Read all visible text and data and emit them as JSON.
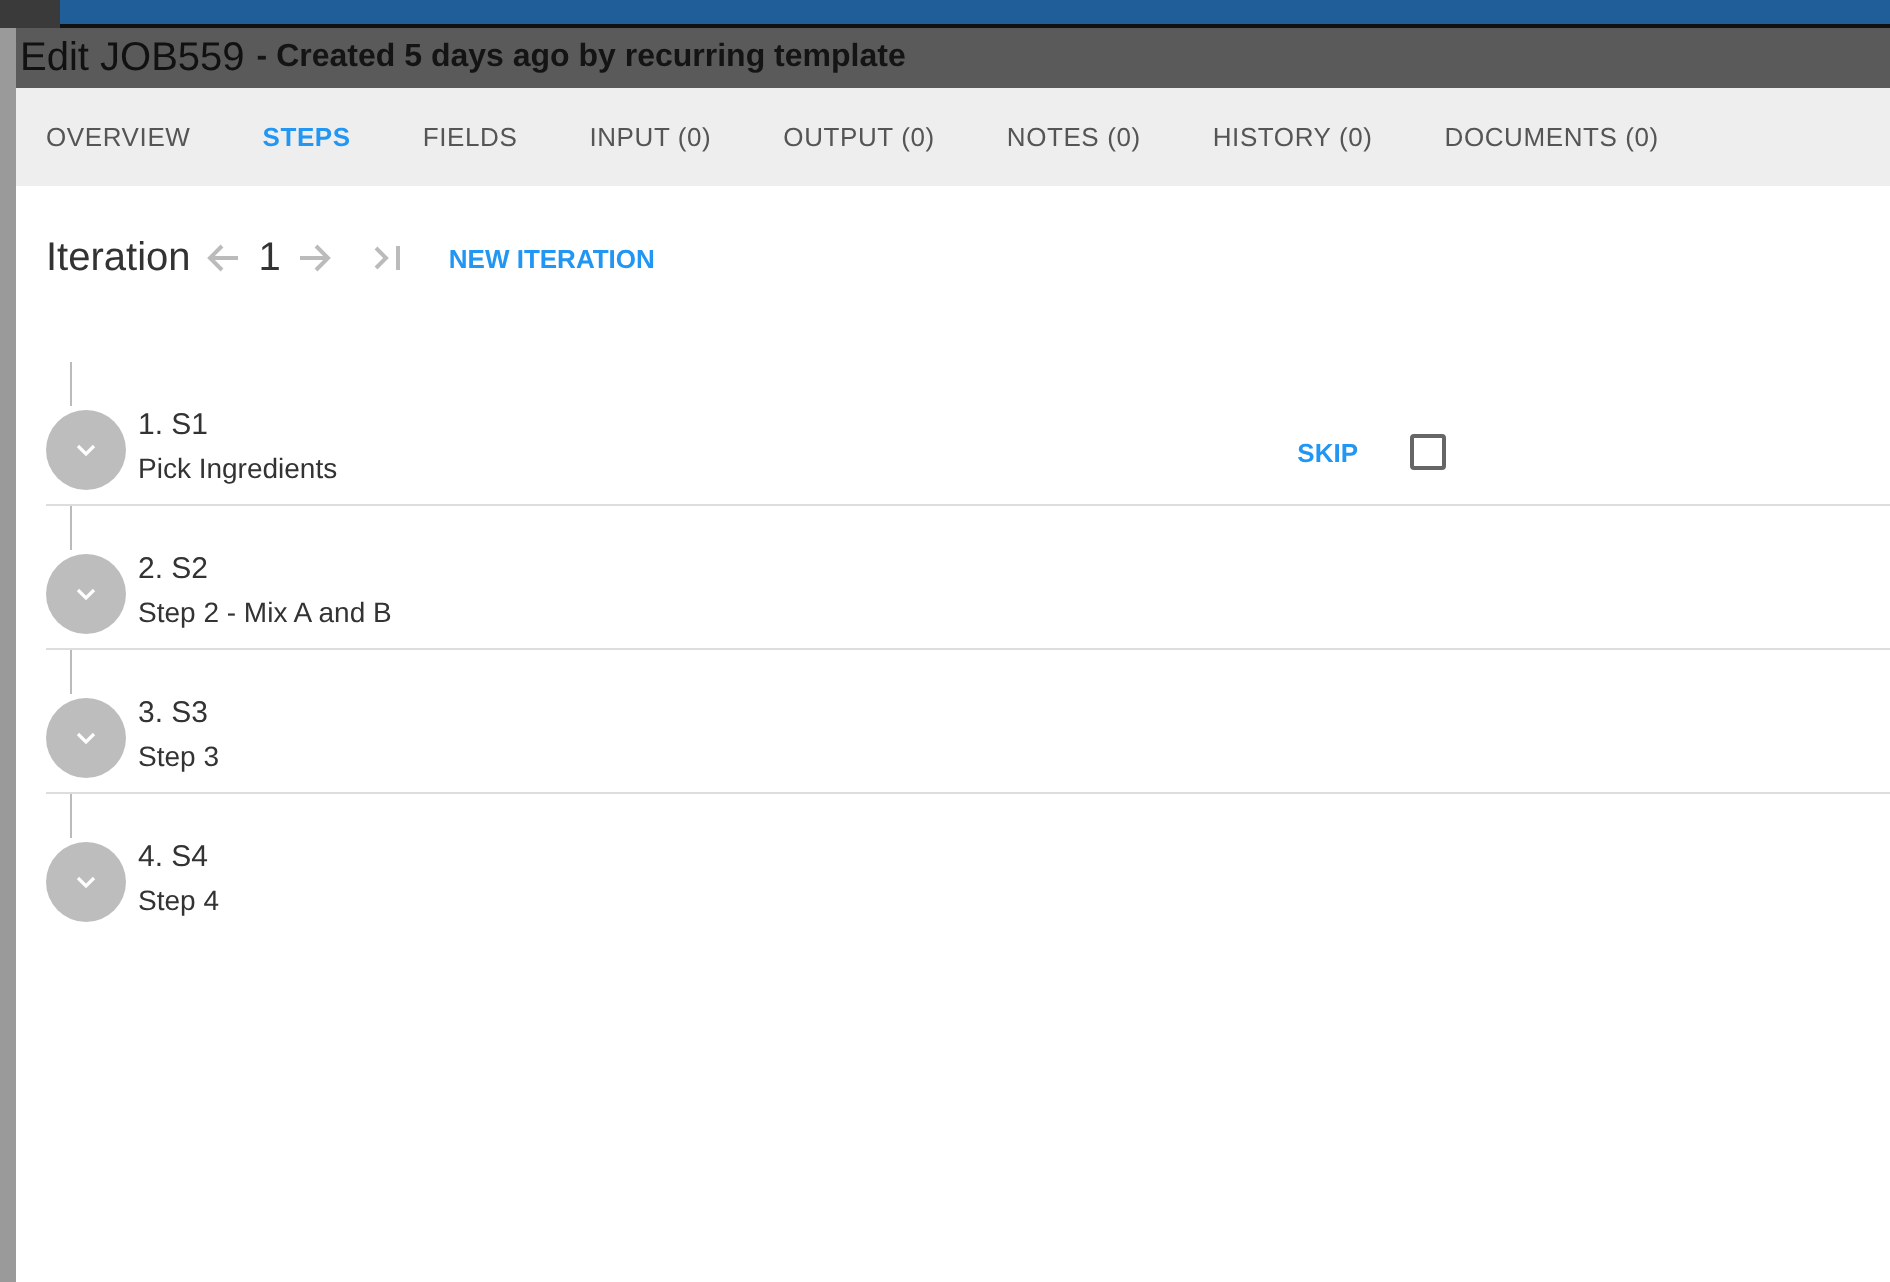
{
  "dialog": {
    "title": "Edit JOB559",
    "subtitle": "- Created 5 days ago by recurring template"
  },
  "tabs": [
    {
      "label": "OVERVIEW",
      "selected": false
    },
    {
      "label": "STEPS",
      "selected": true
    },
    {
      "label": "FIELDS",
      "selected": false
    },
    {
      "label": "INPUT (0)",
      "selected": false
    },
    {
      "label": "OUTPUT (0)",
      "selected": false
    },
    {
      "label": "NOTES (0)",
      "selected": false
    },
    {
      "label": "HISTORY (0)",
      "selected": false
    },
    {
      "label": "DOCUMENTS (0)",
      "selected": false
    }
  ],
  "iteration": {
    "label": "Iteration",
    "number": "1",
    "new_button": "NEW ITERATION"
  },
  "steps": [
    {
      "title": "1. S1",
      "description": "Pick Ingredients",
      "skip_label": "SKIP",
      "checked": false
    },
    {
      "title": "2. S2",
      "description": "Step 2 - Mix A and B"
    },
    {
      "title": "3. S3",
      "description": "Step 3"
    },
    {
      "title": "4. S4",
      "description": "Step 4"
    }
  ]
}
